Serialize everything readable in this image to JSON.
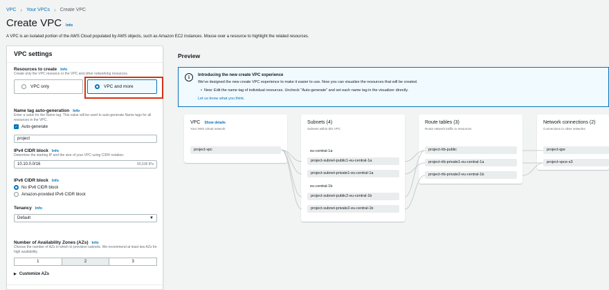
{
  "breadcrumb": [
    "VPC",
    "Your VPCs",
    "Create VPC"
  ],
  "page": {
    "title": "Create VPC",
    "info": "Info",
    "description": "A VPC is an isolated portion of the AWS Cloud populated by AWS objects, such as Amazon EC2 instances. Mouse over a resource to highlight the related resources."
  },
  "settings": {
    "title": "VPC settings",
    "resources": {
      "label": "Resources to create",
      "info": "Info",
      "hint": "Create only the VPC resource or the VPC and other networking resources.",
      "options": [
        "VPC only",
        "VPC and more"
      ],
      "selected": "VPC and more"
    },
    "name_tag": {
      "label": "Name tag auto-generation",
      "info": "Info",
      "hint": "Enter a value for the Name tag. This value will be used to auto-generate Name tags for all resources in the VPC.",
      "auto_label": "Auto-generate",
      "value": "project"
    },
    "ipv4": {
      "label": "IPv4 CIDR block",
      "info": "Info",
      "hint": "Determine the starting IP and the size of your VPC using CIDR notation.",
      "value": "10.10.0.0/16",
      "count": "65,536 IPs"
    },
    "ipv6": {
      "label": "IPv6 CIDR block",
      "info": "Info",
      "options": [
        "No IPv6 CIDR block",
        "Amazon-provided IPv6 CIDR block"
      ]
    },
    "tenancy": {
      "label": "Tenancy",
      "info": "Info",
      "value": "Default"
    },
    "azs": {
      "label": "Number of Availability Zones (AZs)",
      "info": "Info",
      "hint": "Choose the number of AZs in which to provision subnets. We recommend at least two AZs for high availability.",
      "options": [
        "1",
        "2",
        "3"
      ],
      "selected": "2",
      "customize": "Customize AZs"
    }
  },
  "preview": {
    "title": "Preview",
    "banner": {
      "title": "Introducing the new create VPC experience",
      "line1": "We've designed the new create VPC experience to make it easier to use. Now you can visualize the resources that will be created.",
      "bullet": "New: Edit the name tag of individual resources. Uncheck \"Auto-generate\" and set each name tag in the visualizer directly.",
      "link": "Let us know what you think."
    },
    "vpc": {
      "title": "VPC",
      "link": "Show details",
      "sub": "Your AWS virtual network",
      "item": "project-vpc"
    },
    "subnets": {
      "title": "Subnets (4)",
      "sub": "Subnets within this VPC",
      "az1": "eu-central-1a",
      "az2": "eu-central-1b",
      "items": [
        "project-subnet-public1-eu-central-1a",
        "project-subnet-private1-eu-central-1a",
        "project-subnet-public2-eu-central-1b",
        "project-subnet-private2-eu-central-1b"
      ]
    },
    "routes": {
      "title": "Route tables (3)",
      "sub": "Route network traffic to resources",
      "items": [
        "project-rtb-public",
        "project-rtb-private1-eu-central-1a",
        "project-rtb-private2-eu-central-1b"
      ]
    },
    "network": {
      "title": "Network connections (2)",
      "sub": "Connections to other networks",
      "items": [
        "project-igw",
        "project-vpce-s3"
      ]
    }
  },
  "colors": {
    "link": "#0073bb",
    "highlight": "#d13212",
    "background": "#f2f3f3"
  }
}
